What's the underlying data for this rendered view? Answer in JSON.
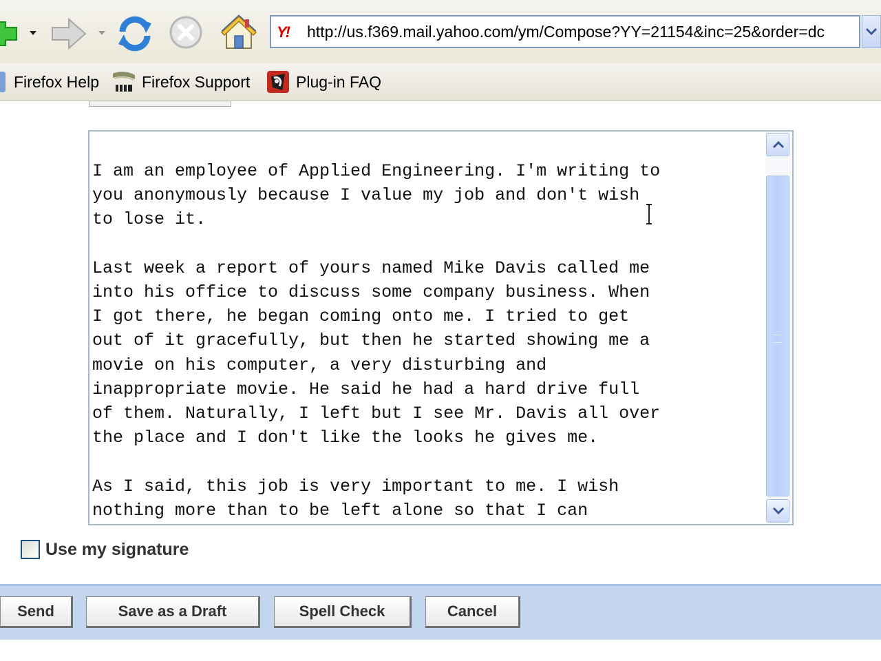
{
  "browser": {
    "url": "http://us.f369.mail.yahoo.com/ym/Compose?YY=21154&inc=25&order=dc",
    "favicon_text": "Y!",
    "bookmarks": [
      {
        "label": "Firefox Help"
      },
      {
        "label": "Firefox Support"
      },
      {
        "label": "Plug-in FAQ"
      }
    ],
    "bookmark_icons": [
      "bookmark-folder-icon",
      "zine-icon",
      "plugin-icon"
    ]
  },
  "compose": {
    "body": "I am an employee of Applied Engineering. I'm writing to\nyou anonymously because I value my job and don't wish\nto lose it.\n\nLast week a report of yours named Mike Davis called me\ninto his office to discuss some company business. When\nI got there, he began coming onto me. I tried to get\nout of it gracefully, but then he started showing me a\nmovie on his computer, a very disturbing and\ninappropriate movie. He said he had a hard drive full\nof them. Naturally, I left but I see Mr. Davis all over\nthe place and I don't like the looks he gives me.\n\nAs I said, this job is very important to me. I wish\nnothing more than to be left alone so that I can ",
    "signature_label": "Use my signature",
    "signature_checked": false
  },
  "actions": {
    "send": "Send",
    "save_draft": "Save as a Draft",
    "spell_check": "Spell Check",
    "cancel": "Cancel"
  },
  "colors": {
    "action_bar": "#c3d6ee",
    "scroll_thumb": "#bcd0fa",
    "toolbar": "#ece9d8"
  }
}
